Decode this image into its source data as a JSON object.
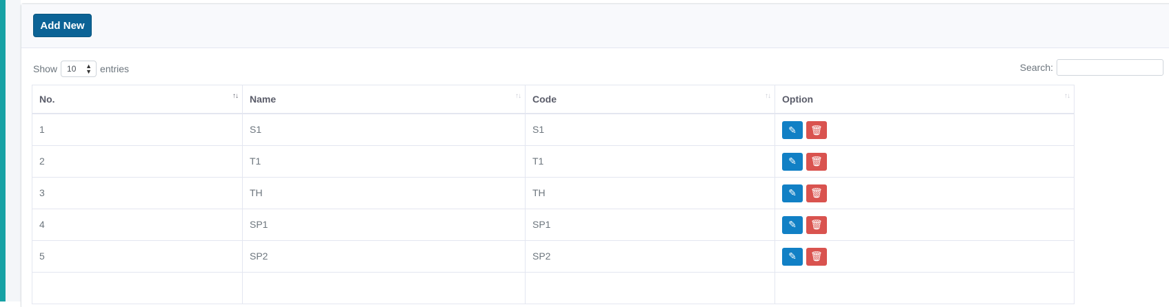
{
  "header": {
    "add_new_label": "Add New"
  },
  "length_control": {
    "show_label": "Show",
    "value": "10",
    "entries_label": "entries"
  },
  "search": {
    "label": "Search:",
    "value": ""
  },
  "table": {
    "columns": [
      "No.",
      "Name",
      "Code",
      "Option"
    ],
    "rows": [
      {
        "no": "1",
        "name": "S1",
        "code": "S1"
      },
      {
        "no": "2",
        "name": "T1",
        "code": "T1"
      },
      {
        "no": "3",
        "name": "TH",
        "code": "TH"
      },
      {
        "no": "4",
        "name": "SP1",
        "code": "SP1"
      },
      {
        "no": "5",
        "name": "SP2",
        "code": "SP2"
      }
    ]
  },
  "icons": {
    "edit": "edit-icon",
    "delete": "trash-icon",
    "sort": "sort-icon"
  },
  "colors": {
    "primary": "#0c6396",
    "edit": "#1180c5",
    "delete": "#d9534f",
    "sidebar": "#17a2a5"
  }
}
